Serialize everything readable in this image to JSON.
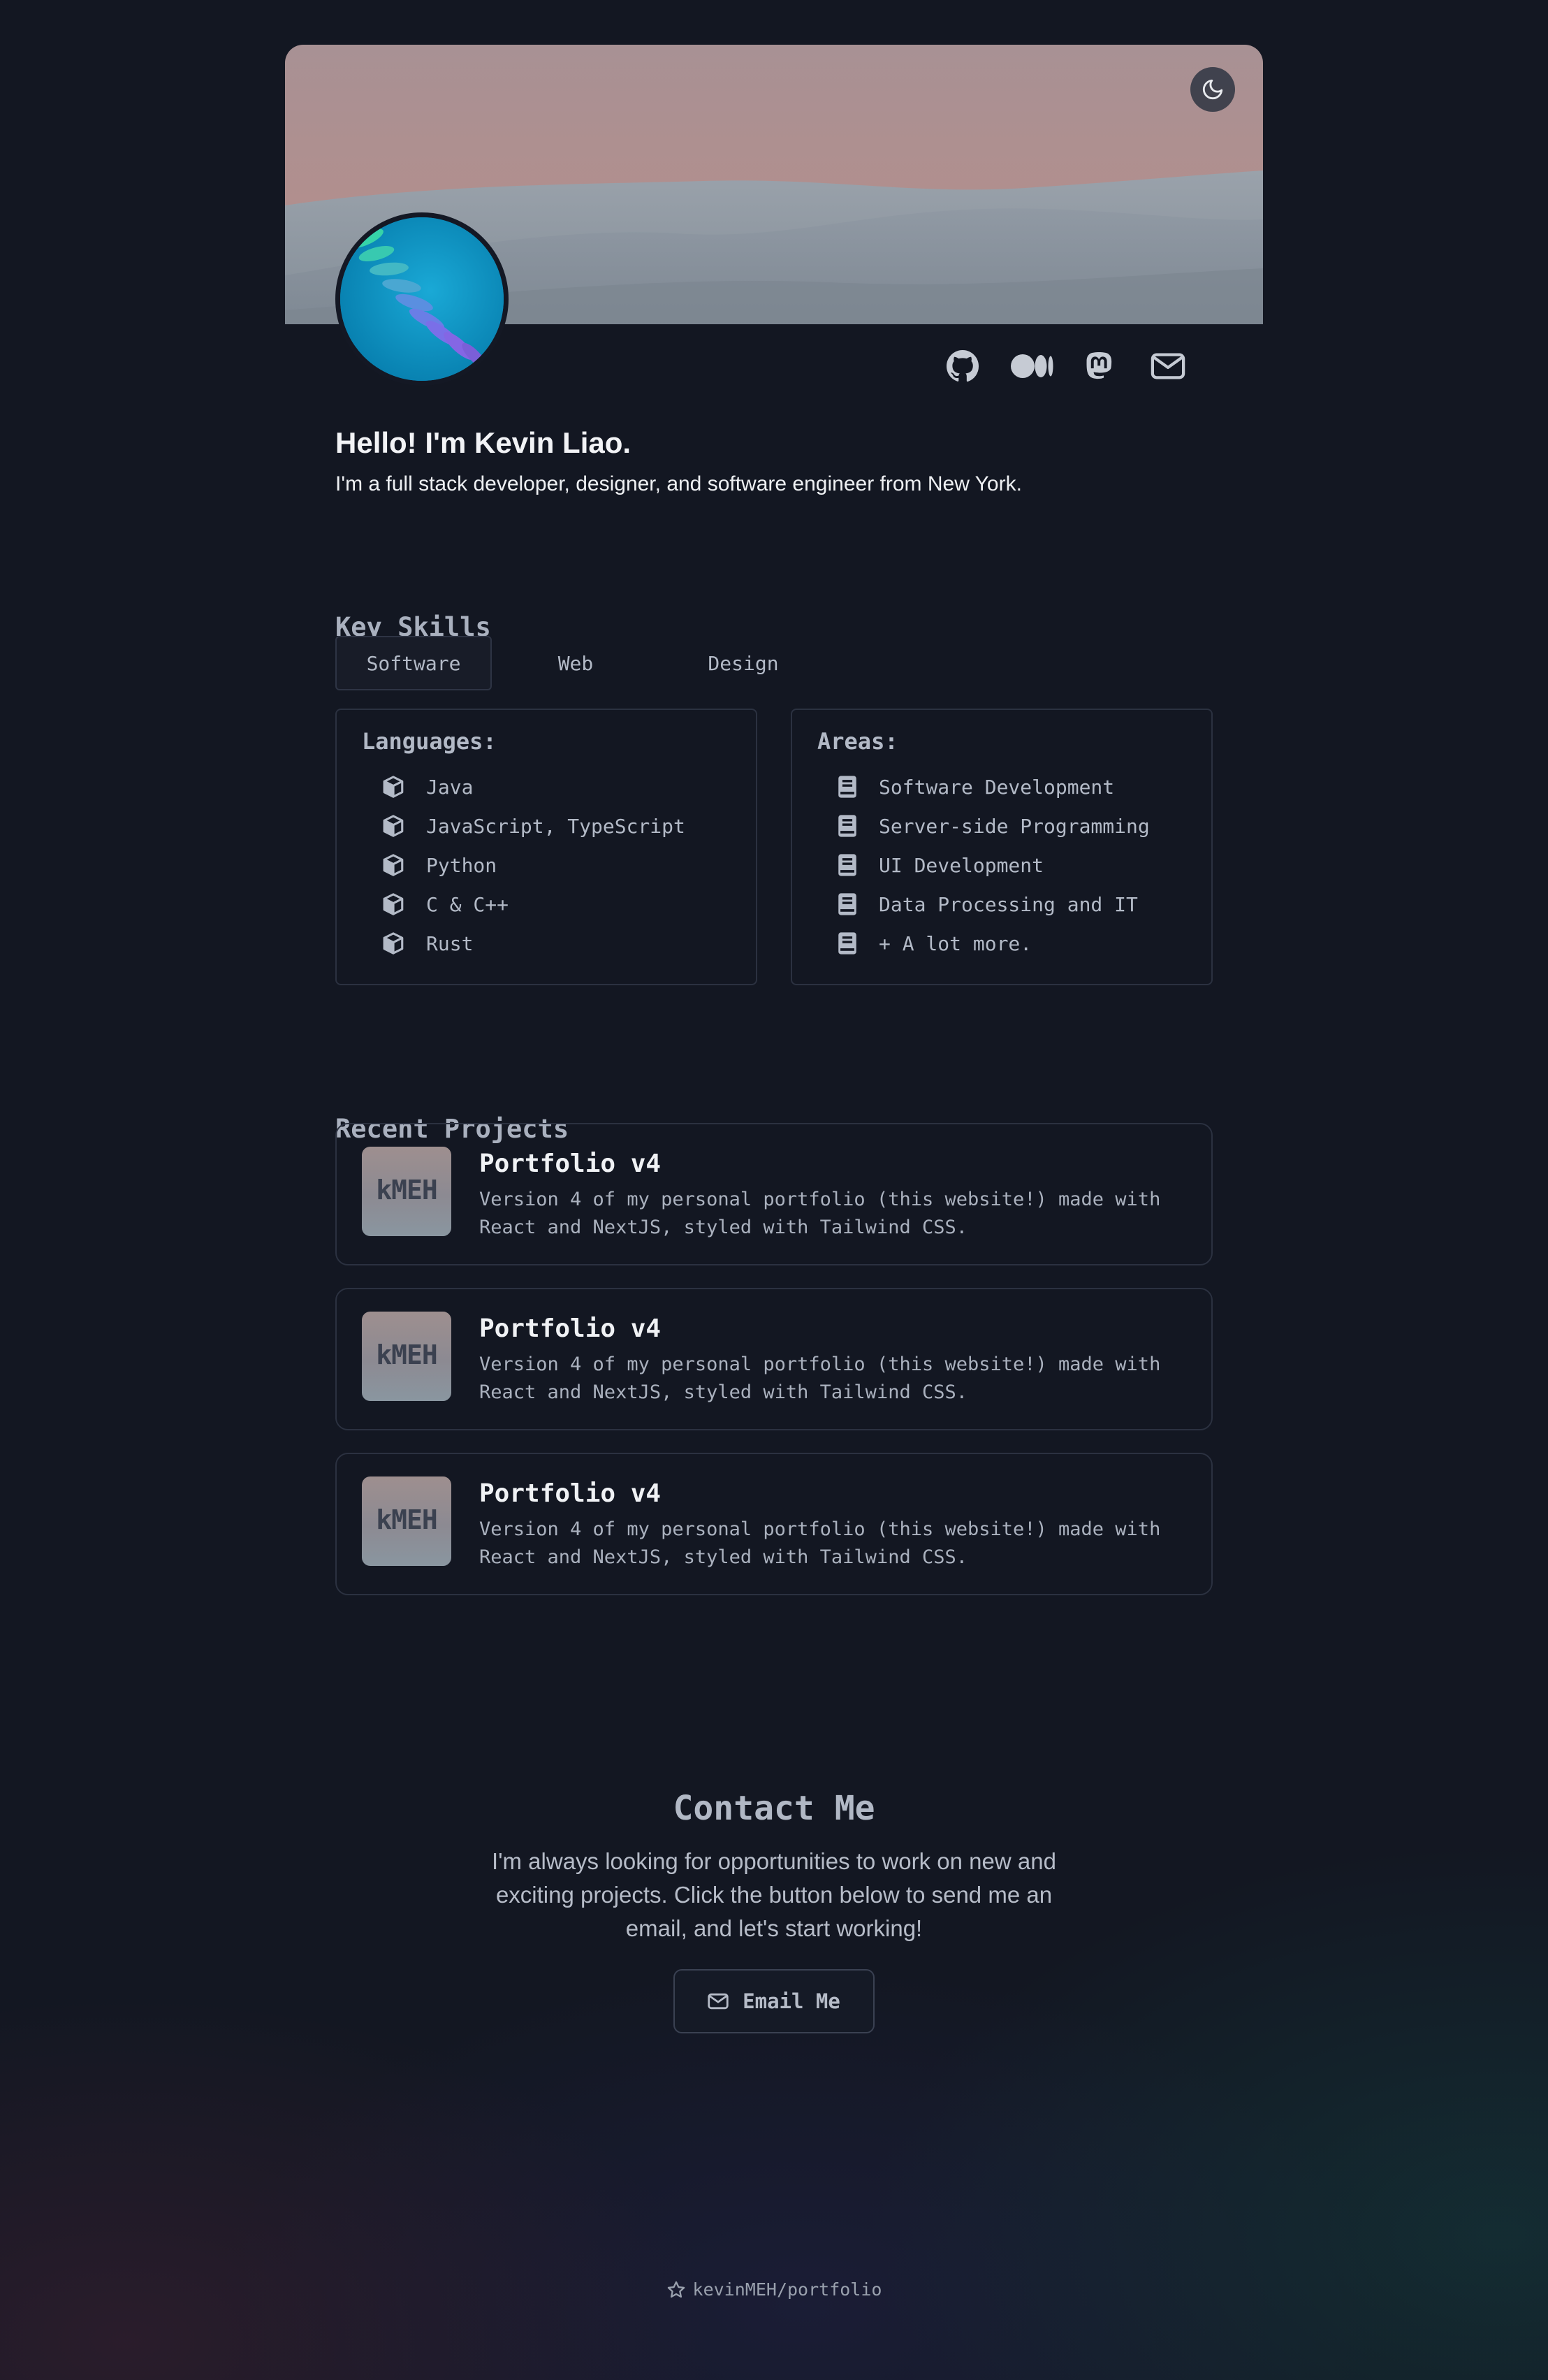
{
  "header": {
    "theme_toggle_icon": "moon-icon",
    "social_links": [
      {
        "name": "github",
        "icon": "github-icon"
      },
      {
        "name": "medium",
        "icon": "medium-icon"
      },
      {
        "name": "mastodon",
        "icon": "mastodon-icon"
      },
      {
        "name": "email",
        "icon": "mail-icon"
      }
    ]
  },
  "intro": {
    "title": "Hello! I'm Kevin Liao.",
    "subtitle": "I'm a full stack developer, designer, and software engineer from New York."
  },
  "skills": {
    "heading": "Key Skills",
    "tabs": [
      "Software",
      "Web",
      "Design"
    ],
    "active_tab": "Software",
    "languages": {
      "heading": "Languages:",
      "icon": "cube-icon",
      "items": [
        "Java",
        "JavaScript, TypeScript",
        "Python",
        "C & C++",
        "Rust"
      ]
    },
    "areas": {
      "heading": "Areas:",
      "icon": "book-icon",
      "items": [
        "Software Development",
        "Server-side Programming",
        "UI Development",
        "Data Processing and IT",
        "+ A lot more."
      ]
    }
  },
  "projects": {
    "heading": "Recent Projects",
    "items": [
      {
        "thumb_text": "kMEH",
        "title": "Portfolio v4",
        "description": "Version 4 of my personal portfolio (this website!) made with React and NextJS, styled with Tailwind CSS."
      },
      {
        "thumb_text": "kMEH",
        "title": "Portfolio v4",
        "description": "Version 4 of my personal portfolio (this website!) made with React and NextJS, styled with Tailwind CSS."
      },
      {
        "thumb_text": "kMEH",
        "title": "Portfolio v4",
        "description": "Version 4 of my personal portfolio (this website!) made with React and NextJS, styled with Tailwind CSS."
      }
    ]
  },
  "contact": {
    "heading": "Contact Me",
    "text": "I'm always looking for opportunities to work on new and exciting projects. Click the button below to send me an email, and let's start working!",
    "button_label": "Email Me"
  },
  "footer": {
    "repo_label": "kevinMEH/portfolio",
    "icon": "star-icon"
  },
  "colors": {
    "background": "#131722",
    "card_border": "#2b3140",
    "text_primary": "#f0f2f5",
    "text_muted": "#aab1be"
  }
}
